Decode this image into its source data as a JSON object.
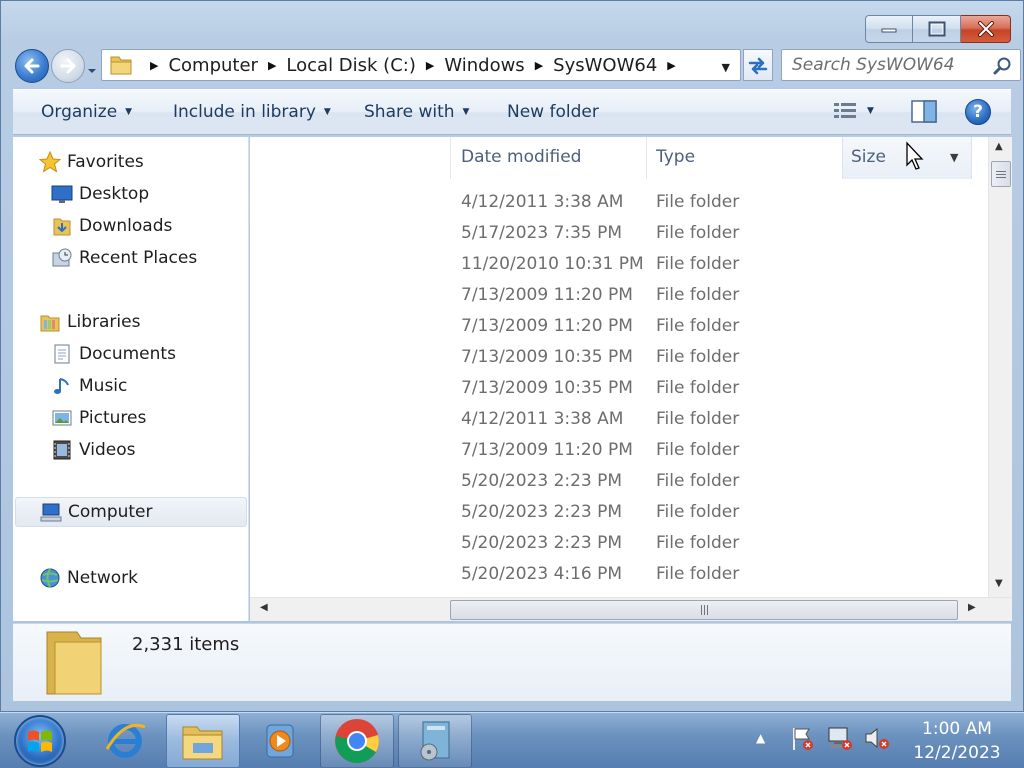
{
  "window": {
    "caption_buttons": [
      "minimize",
      "maximize",
      "close"
    ]
  },
  "navbar": {
    "breadcrumbs": [
      "Computer",
      "Local Disk (C:)",
      "Windows",
      "SysWOW64"
    ],
    "search_placeholder": "Search SysWOW64"
  },
  "toolbar": {
    "organize": "Organize",
    "include_in_library": "Include in library",
    "share_with": "Share with",
    "new_folder": "New folder"
  },
  "navpane": {
    "favorites": "Favorites",
    "desktop": "Desktop",
    "downloads": "Downloads",
    "recent_places": "Recent Places",
    "libraries": "Libraries",
    "documents": "Documents",
    "music": "Music",
    "pictures": "Pictures",
    "videos": "Videos",
    "computer": "Computer",
    "network": "Network"
  },
  "columns": {
    "date_modified": "Date modified",
    "type": "Type",
    "size": "Size"
  },
  "rows": [
    {
      "date": "4/12/2011 3:38 AM",
      "type": "File folder"
    },
    {
      "date": "5/17/2023 7:35 PM",
      "type": "File folder"
    },
    {
      "date": "11/20/2010 10:31 PM",
      "type": "File folder"
    },
    {
      "date": "7/13/2009 11:20 PM",
      "type": "File folder"
    },
    {
      "date": "7/13/2009 11:20 PM",
      "type": "File folder"
    },
    {
      "date": "7/13/2009 10:35 PM",
      "type": "File folder"
    },
    {
      "date": "7/13/2009 10:35 PM",
      "type": "File folder"
    },
    {
      "date": "4/12/2011 3:38 AM",
      "type": "File folder"
    },
    {
      "date": "7/13/2009 11:20 PM",
      "type": "File folder"
    },
    {
      "date": "5/20/2023 2:23 PM",
      "type": "File folder"
    },
    {
      "date": "5/20/2023 2:23 PM",
      "type": "File folder"
    },
    {
      "date": "5/20/2023 2:23 PM",
      "type": "File folder"
    },
    {
      "date": "5/20/2023 4:16 PM",
      "type": "File folder"
    }
  ],
  "details": {
    "item_count": "2,331 items"
  },
  "taskbar": {
    "apps": [
      "start-orb",
      "internet-explorer",
      "windows-explorer",
      "media-player",
      "chrome",
      "system-app"
    ],
    "time": "1:00 AM",
    "date": "12/2/2023"
  },
  "colors": {
    "accent": "#2d6fc0",
    "taskbar": "#6c92bf",
    "close_button": "#c44525"
  }
}
